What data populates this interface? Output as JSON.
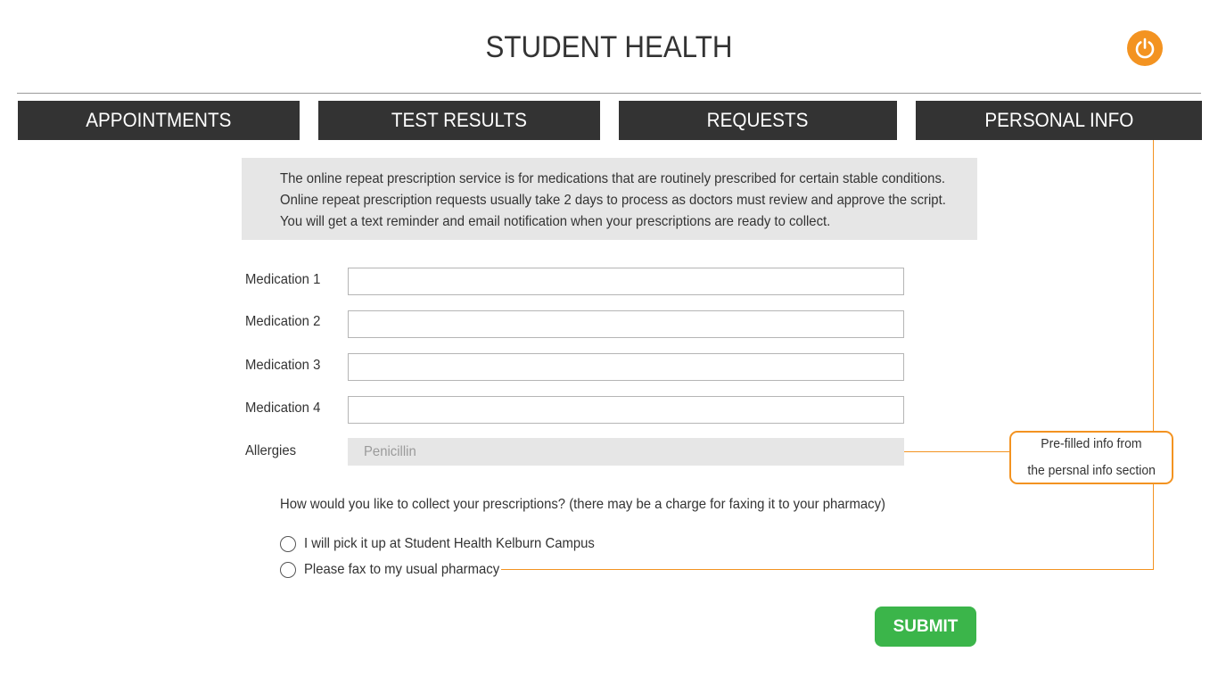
{
  "colors": {
    "accent": "#f39321",
    "nav_bg": "#333333",
    "submit": "#3bb54a",
    "panel_bg": "#e6e6e6"
  },
  "header": {
    "title": "STUDENT HEALTH",
    "power_icon": "power-icon"
  },
  "nav": {
    "tabs": [
      {
        "label": "APPOINTMENTS"
      },
      {
        "label": "TEST RESULTS"
      },
      {
        "label": "REQUESTS"
      },
      {
        "label": "PERSONAL INFO"
      }
    ]
  },
  "info": {
    "lines": [
      "The online repeat prescription service is for medications that are routinely prescribed for certain stable conditions.",
      "Online repeat prescription requests usually take 2 days to process as doctors must review and approve the script.",
      "You will get a text reminder and email notification when your prescriptions are ready to collect."
    ]
  },
  "form": {
    "medications": [
      {
        "label": "Medication 1",
        "value": ""
      },
      {
        "label": "Medication 2",
        "value": ""
      },
      {
        "label": "Medication 3",
        "value": ""
      },
      {
        "label": "Medication 4",
        "value": ""
      }
    ],
    "allergies": {
      "label": "Allergies",
      "value": "Penicillin"
    },
    "question": "How would you like to collect your prescriptions? (there may be a charge for faxing it to your pharmacy)",
    "options": [
      {
        "label": "I will pick it up at Student Health Kelburn Campus"
      },
      {
        "label": "Please fax to my usual pharmacy"
      }
    ],
    "submit_label": "SUBMIT"
  },
  "annotation": {
    "lines": [
      "Pre-filled info from",
      "the persnal info section"
    ]
  }
}
